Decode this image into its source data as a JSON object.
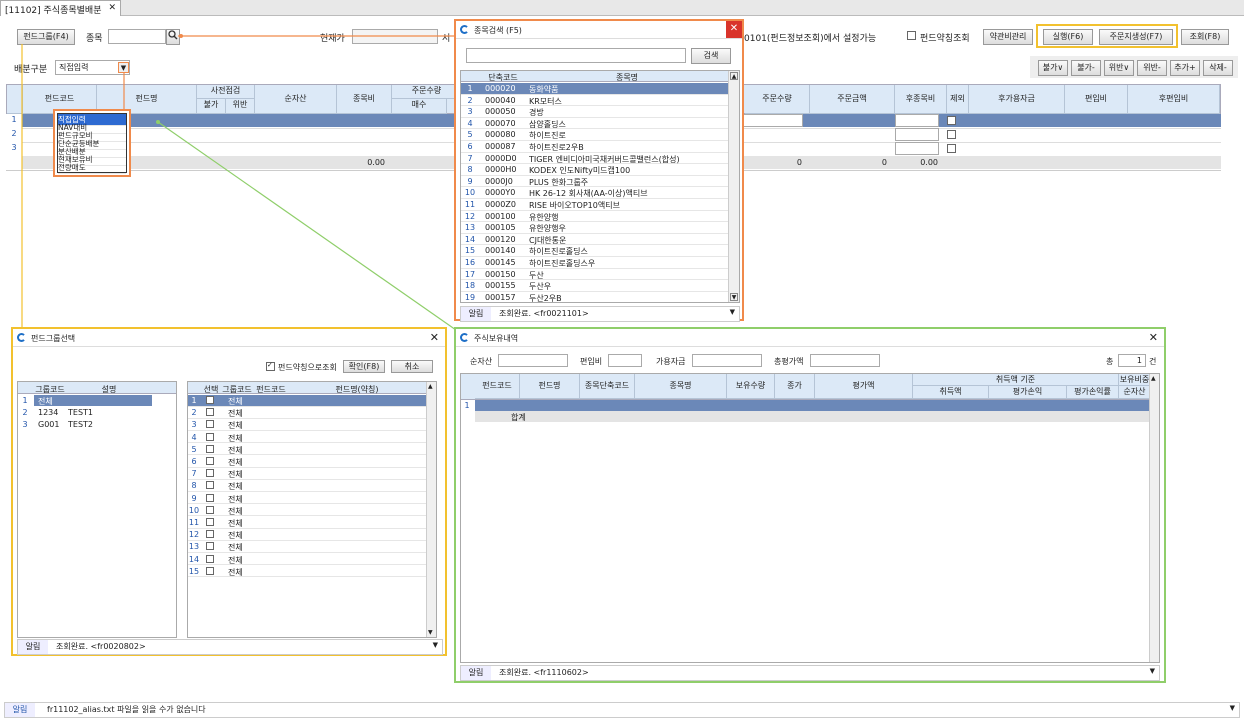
{
  "tab": {
    "label": "[11102] 주식종목별배분",
    "close": "✕"
  },
  "toolbar": {
    "fund_group_btn": "펀드그룹(F4)",
    "stock_label": "종목",
    "curprice_label": "현재가",
    "hint_text": "0101(펀드정보조회)에서 설정가능",
    "fund_abbrev_check": "펀드약칭조회",
    "terms_btn": "약관비관리",
    "run_btn": "실행(F6)",
    "order_btn": "주문지생성(F7)",
    "search_btn": "조회(F8)"
  },
  "alloc": {
    "label": "배분구분",
    "value": "직접입력"
  },
  "right_buttons": [
    "불가∨",
    "불가-",
    "위반∨",
    "위반-",
    "추가+",
    "삭제-"
  ],
  "main_grid": {
    "headers": [
      "펀드코드",
      "펀드명",
      "사전점검",
      "불가",
      "위반",
      "순자산",
      "종목비",
      "주문수량",
      "매수",
      "주문수량",
      "주문금액",
      "후종목비",
      "제외",
      "후가용자금",
      "편입비",
      "후편입비"
    ],
    "rows": [
      "1",
      "2",
      "3"
    ],
    "totals": {
      "a": "0.00",
      "b": "0",
      "c": "0",
      "d": "0.00"
    }
  },
  "dropdown": {
    "items": [
      "직접입력",
      "NAV대비",
      "펀드규모비",
      "단순균등배분",
      "분산배분",
      "현재보유비",
      "전량매도"
    ]
  },
  "stock_search": {
    "title": "종목검색 (F5)",
    "search_btn": "검색",
    "headers": [
      "단축코드",
      "종목명"
    ],
    "rows": [
      {
        "n": "1",
        "code": "000020",
        "name": "동화약품"
      },
      {
        "n": "2",
        "code": "000040",
        "name": "KR모터스"
      },
      {
        "n": "3",
        "code": "000050",
        "name": "경방"
      },
      {
        "n": "4",
        "code": "000070",
        "name": "삼양홀딩스"
      },
      {
        "n": "5",
        "code": "000080",
        "name": "하이트진로"
      },
      {
        "n": "6",
        "code": "000087",
        "name": "하이트진로2우B"
      },
      {
        "n": "7",
        "code": "0000D0",
        "name": "TIGER 엔비디아미국채커버드콜밸런스(합성)"
      },
      {
        "n": "8",
        "code": "0000H0",
        "name": "KODEX 인도Nifty미드캡100"
      },
      {
        "n": "9",
        "code": "0000J0",
        "name": "PLUS 한화그룹주"
      },
      {
        "n": "10",
        "code": "0000Y0",
        "name": "HK 26-12 회사채(AA-이상)액티브"
      },
      {
        "n": "11",
        "code": "0000Z0",
        "name": "RISE 바이오TOP10액티브"
      },
      {
        "n": "12",
        "code": "000100",
        "name": "유한양행"
      },
      {
        "n": "13",
        "code": "000105",
        "name": "유한양행우"
      },
      {
        "n": "14",
        "code": "000120",
        "name": "CJ대한통운"
      },
      {
        "n": "15",
        "code": "000140",
        "name": "하이트진로홀딩스"
      },
      {
        "n": "16",
        "code": "000145",
        "name": "하이트진로홀딩스우"
      },
      {
        "n": "17",
        "code": "000150",
        "name": "두산"
      },
      {
        "n": "18",
        "code": "000155",
        "name": "두산우"
      },
      {
        "n": "19",
        "code": "000157",
        "name": "두산2우B"
      }
    ],
    "status_k": "알림",
    "status_v": "조회완료. <fr0021101>"
  },
  "fund_group": {
    "title": "펀드그룹선택",
    "check_label": "펀드약칭으로조회",
    "ok_btn": "확인(F8)",
    "cancel_btn": "취소",
    "left_headers": [
      "그룹코드",
      "설명"
    ],
    "left_rows": [
      {
        "n": "1",
        "code": "전체",
        "desc": ""
      },
      {
        "n": "2",
        "code": "1234",
        "desc": "TEST1"
      },
      {
        "n": "3",
        "code": "G001",
        "desc": "TEST2"
      }
    ],
    "right_headers": [
      "선택",
      "그룹코드",
      "펀드코드",
      "펀드명(약칭)"
    ],
    "right_rows": [
      "1",
      "2",
      "3",
      "4",
      "5",
      "6",
      "7",
      "8",
      "9",
      "10",
      "11",
      "12",
      "13",
      "14",
      "15"
    ],
    "right_group": "전체",
    "status_k": "알림",
    "status_v": "조회완료. <fr0020802>"
  },
  "holdings": {
    "title": "주식보유내역",
    "netasset_label": "순자산",
    "incl_label": "편입비",
    "avail_label": "가용자금",
    "eval_label": "총평가액",
    "total_label": "총",
    "total_value": "1",
    "total_unit": "건",
    "headers": [
      "펀드코드",
      "펀드명",
      "종목단축코드",
      "종목명",
      "보유수량",
      "종가",
      "평가액",
      "취득액 기준",
      "취득액",
      "평가손익",
      "평가손익률",
      "보유비중",
      "순자산"
    ],
    "row1": "1",
    "sum_label": "합계",
    "status_k": "알림",
    "status_v": "조회완료. <fr1110602>"
  },
  "bottom_status": {
    "k": "알림",
    "v": "fr11102_alias.txt 파일을 읽을 수가 없습니다"
  },
  "colors": {
    "orange": "#f08a4b",
    "yellow": "#f2c12e",
    "green": "#8fce6a",
    "select": "#6b88b8",
    "header": "#dce9f7"
  }
}
